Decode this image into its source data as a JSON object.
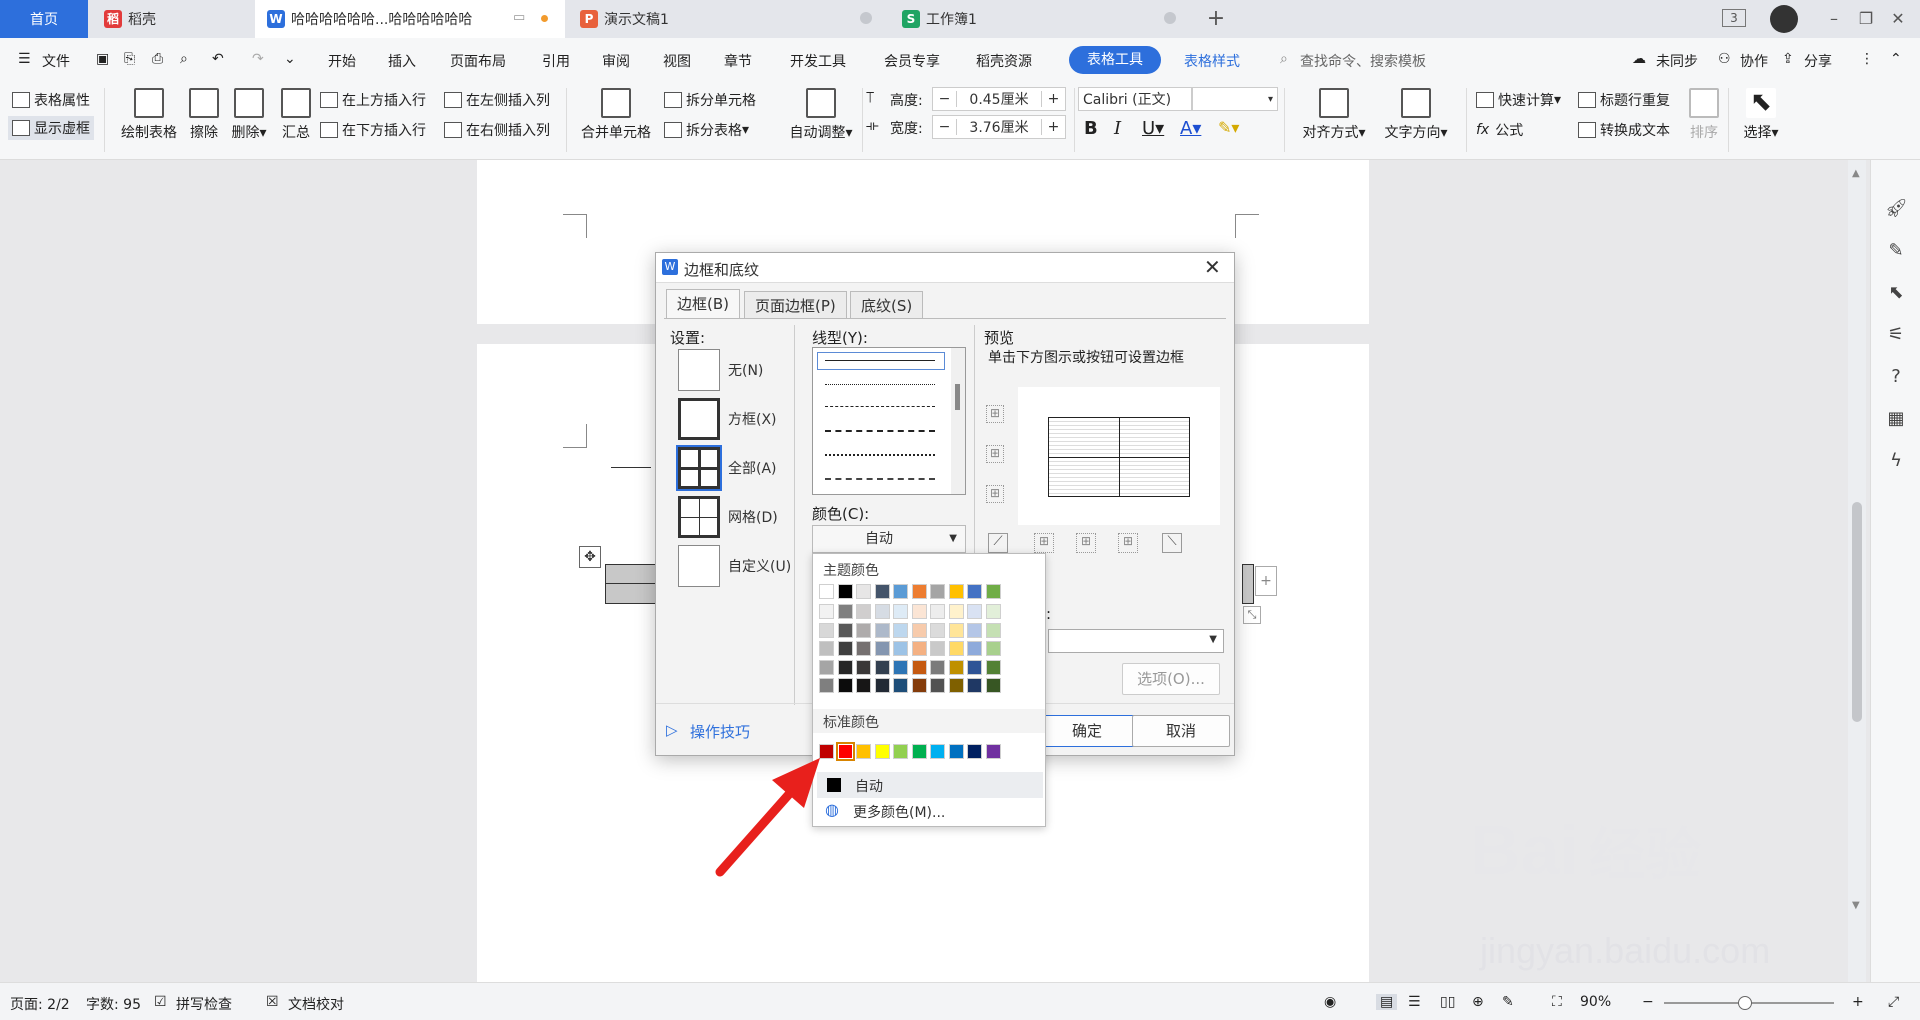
{
  "tabs": {
    "home": "首页",
    "daoke": "稻壳",
    "doc1": "哈哈哈哈哈哈...哈哈哈哈哈哈",
    "ppt": "演示文稿1",
    "xls": "工作簿1",
    "count_badge": "3"
  },
  "menubar": {
    "file": "文件",
    "items": [
      "开始",
      "插入",
      "页面布局",
      "引用",
      "审阅",
      "视图",
      "章节",
      "开发工具",
      "会员专享",
      "稻壳资源"
    ],
    "active_tab": "表格工具",
    "table_style_tab": "表格样式",
    "search": "查找命令、搜索模板",
    "sync": "未同步",
    "collab": "协作",
    "share": "分享"
  },
  "ribbon": {
    "table_props": "表格属性",
    "show_grid": "显示虚框",
    "draw_table": "绘制表格",
    "erase": "擦除",
    "delete": "删除",
    "summary": "汇总",
    "insert_above": "在上方插入行",
    "insert_below": "在下方插入行",
    "insert_left": "在左侧插入列",
    "insert_right": "在右侧插入列",
    "merge_cells": "合并单元格",
    "split_cells": "拆分单元格",
    "split_table": "拆分表格",
    "auto_fit": "自动调整",
    "height_label": "高度:",
    "height_value": "0.45厘米",
    "width_label": "宽度:",
    "width_value": "3.76厘米",
    "font_name": "Calibri (正文)",
    "align": "对齐方式",
    "text_dir": "文字方向",
    "quick_calc": "快速计算",
    "formula": "公式",
    "header_repeat": "标题行重复",
    "to_text": "转换成文本",
    "sort": "排序",
    "select": "选择",
    "minus": "−",
    "plus": "+"
  },
  "dialog": {
    "title": "边框和底纹",
    "tabs": [
      "边框(B)",
      "页面边框(P)",
      "底纹(S)"
    ],
    "settings_label": "设置:",
    "settings": [
      "无(N)",
      "方框(X)",
      "全部(A)",
      "网格(D)",
      "自定义(U)"
    ],
    "line_style_label": "线型(Y):",
    "color_label": "颜色(C):",
    "color_value": "自动",
    "preview_label": "预览",
    "preview_hint": "单击下方图示或按钮可设置边框",
    "options_btn": "选项(O)...",
    "ok": "确定",
    "cancel": "取消",
    "tips": "操作技巧",
    "apply_colon": ":"
  },
  "picker": {
    "theme_label": "主题颜色",
    "standard_label": "标准颜色",
    "auto": "自动",
    "more": "更多颜色(M)...",
    "theme_top": [
      "#ffffff",
      "#000000",
      "#e7e6e6",
      "#44546a",
      "#5b9bd5",
      "#ed7d31",
      "#a5a5a5",
      "#ffc000",
      "#4472c4",
      "#70ad47"
    ],
    "theme_shades": [
      [
        "#f2f2f2",
        "#7f7f7f",
        "#d0cece",
        "#d6dce4",
        "#deebf6",
        "#fbe5d5",
        "#ededed",
        "#fff2cc",
        "#d9e2f3",
        "#e2efd9"
      ],
      [
        "#d8d8d8",
        "#595959",
        "#aeabab",
        "#adb9ca",
        "#bdd7ee",
        "#f7cbac",
        "#dbdbdb",
        "#ffe599",
        "#b4c6e7",
        "#c5e0b3"
      ],
      [
        "#bfbfbf",
        "#3f3f3f",
        "#757070",
        "#8496b0",
        "#9dc3e6",
        "#f4b183",
        "#c9c9c9",
        "#ffd965",
        "#8eaadb",
        "#a8d08d"
      ],
      [
        "#a5a5a5",
        "#262626",
        "#3a3838",
        "#323f4f",
        "#2e75b5",
        "#c55a11",
        "#7b7b7b",
        "#bf9000",
        "#2f5496",
        "#538135"
      ],
      [
        "#7f7f7f",
        "#0c0c0c",
        "#171616",
        "#222a35",
        "#1e4e79",
        "#843c0b",
        "#525252",
        "#7f6000",
        "#1f3864",
        "#375623"
      ]
    ],
    "standard": [
      "#c00000",
      "#ff0000",
      "#ffc000",
      "#ffff00",
      "#92d050",
      "#00b050",
      "#00b0f0",
      "#0070c0",
      "#002060",
      "#7030a0"
    ],
    "selected_standard_index": 1
  },
  "status": {
    "page": "页面: 2/2",
    "words": "字数: 95",
    "spell": "拼写检查",
    "proof": "文档校对",
    "zoom": "90%",
    "zoom_minus": "−",
    "zoom_plus": "+"
  },
  "watermark": {
    "brand": "Bai",
    "brand2": "经验",
    "url": "jingyan.baidu.com"
  },
  "colors": {
    "accent": "#2d6fdc",
    "arrow": "#e8201c"
  }
}
